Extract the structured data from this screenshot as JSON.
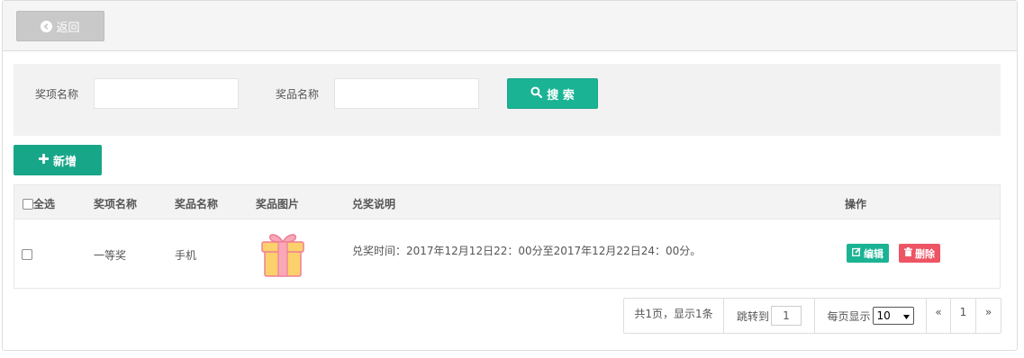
{
  "header": {
    "back_label": "返回"
  },
  "search": {
    "field1_label": "奖项名称",
    "field1_value": "",
    "field2_label": "奖品名称",
    "field2_value": "",
    "search_label": "搜 索"
  },
  "toolbar": {
    "add_label": "新增"
  },
  "table": {
    "columns": [
      "全选",
      "奖项名称",
      "奖品名称",
      "奖品图片",
      "兑奖说明",
      "操作"
    ],
    "rows": [
      {
        "award_name": "一等奖",
        "prize_name": "手机",
        "prize_image": "gift-icon",
        "description": "兑奖时间：2017年12月12日22：00分至2017年12月22日24：00分。",
        "edit_label": "编辑",
        "delete_label": "删除"
      }
    ]
  },
  "pager": {
    "summary": "共1页，显示1条",
    "jump_label": "跳转到",
    "jump_value": "1",
    "per_page_label": "每页显示",
    "per_page_value": "10",
    "prev": "«",
    "current_page": "1",
    "next": "»"
  },
  "colors": {
    "primary": "#1ab394",
    "danger": "#ed5565",
    "back_button": "#c9c9c9"
  }
}
